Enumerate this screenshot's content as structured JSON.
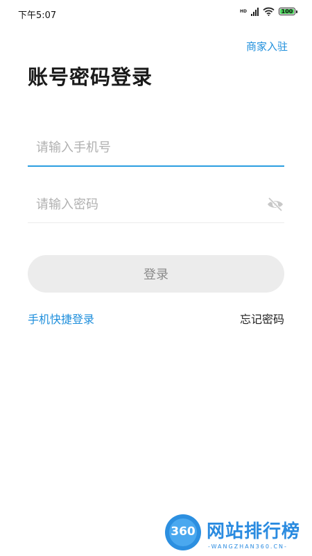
{
  "status_bar": {
    "time": "下午5:07",
    "network_label": "HD",
    "battery": "100",
    "battery_level": 1.0,
    "battery_color": "#49d35a"
  },
  "header": {
    "merchant_link": "商家入驻",
    "title": "账号密码登录"
  },
  "form": {
    "phone_placeholder": "请输入手机号",
    "phone_value": "",
    "password_placeholder": "请输入密码",
    "password_value": "",
    "login_button": "登录"
  },
  "links": {
    "quick_login": "手机快捷登录",
    "forgot_password": "忘记密码"
  },
  "watermark": {
    "badge": "360",
    "name": "网站排行榜",
    "domain": "-WANGZHAN360.CN-"
  },
  "colors": {
    "accent": "#1f8fdc",
    "underline_active": "#2a9ee0",
    "button_bg": "#ececec"
  },
  "icons": {
    "visibility": "eye-off-icon",
    "wifi": "wifi-icon",
    "signal": "signal-icon",
    "battery": "battery-icon"
  }
}
